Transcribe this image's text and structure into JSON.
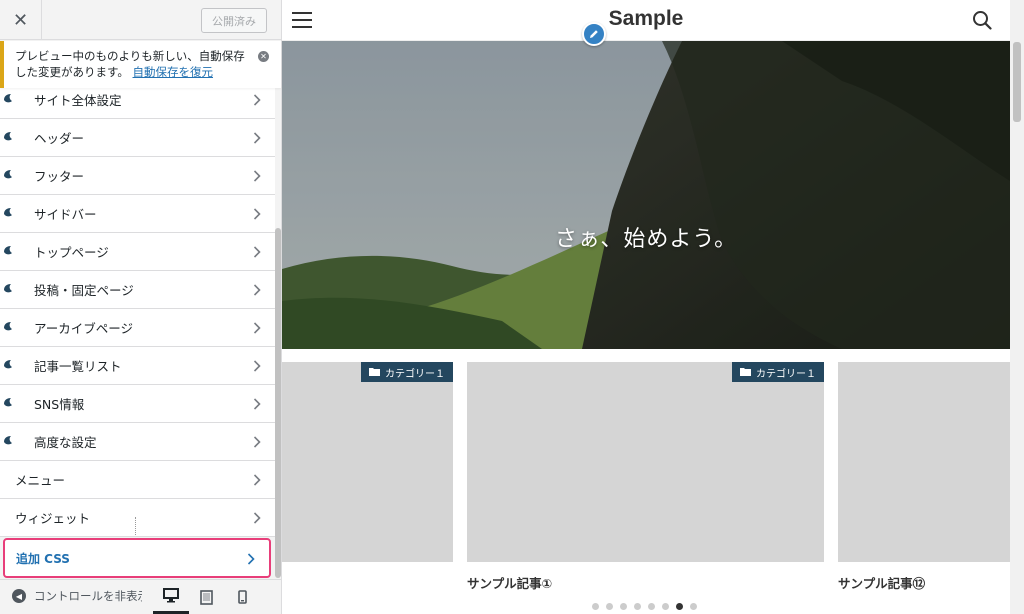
{
  "customizer": {
    "close_label": "✕",
    "publish_label": "公開済み",
    "notice": {
      "text": "プレビュー中のものよりも新しい、自動保存した変更があります。",
      "link": "自動保存を復元"
    },
    "sections": [
      {
        "label": "サイト全体設定",
        "icon": "swell-icon"
      },
      {
        "label": "ヘッダー",
        "icon": "swell-icon"
      },
      {
        "label": "フッター",
        "icon": "swell-icon"
      },
      {
        "label": "サイドバー",
        "icon": "swell-icon"
      },
      {
        "label": "トップページ",
        "icon": "swell-icon"
      },
      {
        "label": "投稿・固定ページ",
        "icon": "swell-icon"
      },
      {
        "label": "アーカイブページ",
        "icon": "swell-icon"
      },
      {
        "label": "記事一覧リスト",
        "icon": "swell-icon"
      },
      {
        "label": "SNS情報",
        "icon": "swell-icon"
      },
      {
        "label": "高度な設定",
        "icon": "swell-icon"
      }
    ],
    "plain_sections": [
      {
        "label": "メニュー"
      },
      {
        "label": "ウィジェット"
      }
    ],
    "highlighted_section": {
      "label": "追加 CSS",
      "highlight_color": "#e83e7a"
    },
    "footer": {
      "collapse_label": "コントロールを非表示",
      "devices": [
        "desktop",
        "tablet",
        "mobile"
      ],
      "active_device": "desktop"
    }
  },
  "preview": {
    "site_title": "Sample",
    "hero_text": "さぁ、始めよう。",
    "cards": [
      {
        "category": "カテゴリー１",
        "title": ""
      },
      {
        "category": "カテゴリー１",
        "title": "サンプル記事①"
      },
      {
        "category": "",
        "title": "サンプル記事⑫"
      }
    ],
    "slider": {
      "dot_count": 8,
      "active_index": 6
    }
  },
  "colors": {
    "accent": "#2271b1",
    "notice_border": "#dba617",
    "category_badge": "#24475f",
    "highlight": "#e83e7a"
  }
}
